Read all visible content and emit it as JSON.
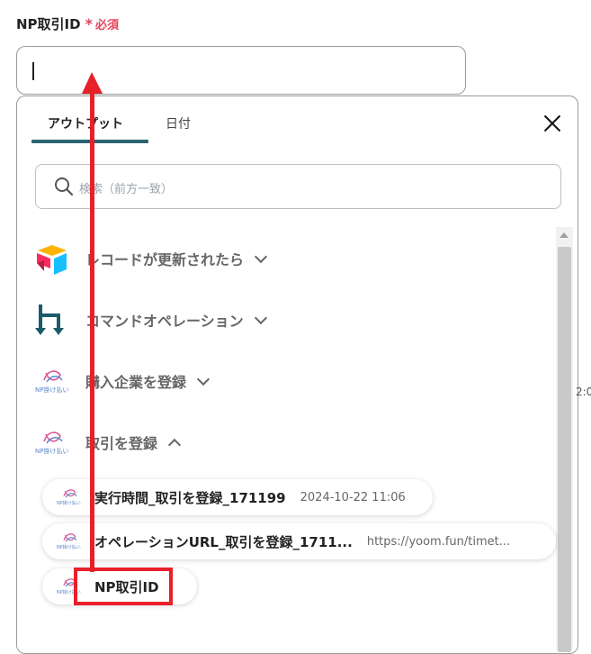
{
  "field": {
    "label": "NP取引ID",
    "required_star": "*",
    "required_text": "必須",
    "value": ""
  },
  "panel": {
    "tabs": [
      {
        "label": "アウトプット",
        "active": true
      },
      {
        "label": "日付",
        "active": false
      }
    ],
    "search_placeholder": "検索（前方一致）",
    "sections": [
      {
        "label": "レコードが更新されたら",
        "icon": "airtable-icon",
        "expanded": false
      },
      {
        "label": "コマンドオペレーション",
        "icon": "command-operation-icon",
        "expanded": false
      },
      {
        "label": "購入企業を登録",
        "icon": "np-logo-icon",
        "expanded": false
      },
      {
        "label": "取引を登録",
        "icon": "np-logo-icon",
        "expanded": true
      }
    ],
    "np_logo_text": "NP掛け払い",
    "items": [
      {
        "name": "実行時間_取引を登録_171199",
        "value": "2024-10-22 11:06"
      },
      {
        "name": "オペレーションURL_取引を登録_1711...",
        "value": "https://yoom.fun/timet..."
      },
      {
        "name": "NP取引ID",
        "value": ""
      }
    ]
  },
  "side_fragment": "2:0",
  "colors": {
    "accent": "#2c6470",
    "required": "#e4435a",
    "annotation": "#e8202a"
  }
}
